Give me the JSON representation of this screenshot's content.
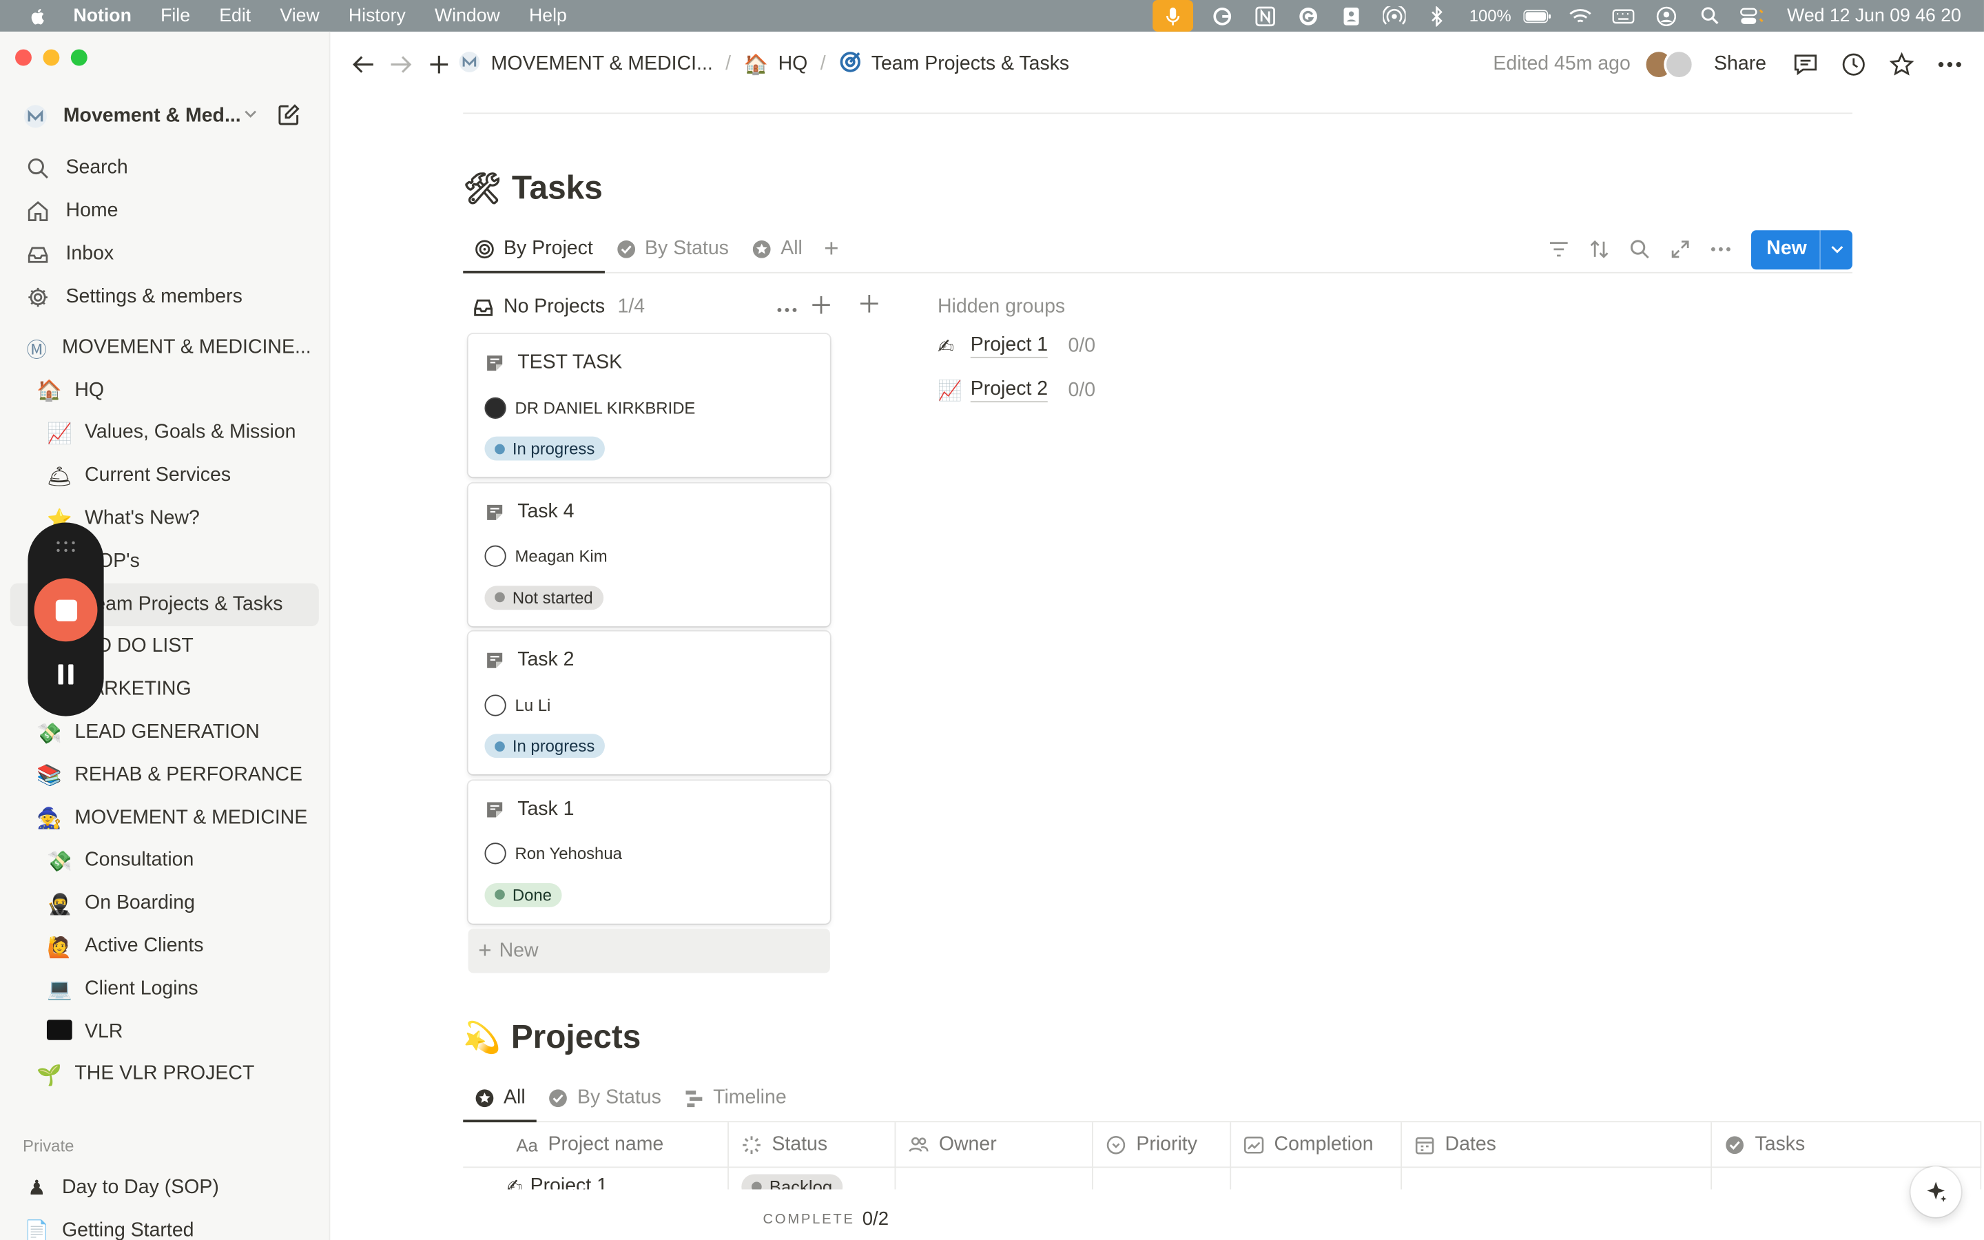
{
  "menubar": {
    "app": "Notion",
    "items": [
      "File",
      "Edit",
      "View",
      "History",
      "Window",
      "Help"
    ],
    "battery": "100%",
    "clock": "Wed 12 Jun  09 46 20"
  },
  "sidebar": {
    "workspace": "Movement & Med...",
    "nav": [
      {
        "label": "Search",
        "icon": "search-icon"
      },
      {
        "label": "Home",
        "icon": "home-icon"
      },
      {
        "label": "Inbox",
        "icon": "inbox-icon"
      },
      {
        "label": "Settings & members",
        "icon": "gear-icon"
      }
    ],
    "tree": [
      {
        "label": "MOVEMENT & MEDICINE...",
        "emoji": "Ⓜ",
        "level": 0
      },
      {
        "label": "HQ",
        "emoji": "🏠",
        "level": 1
      },
      {
        "label": "Values, Goals & Mission",
        "emoji": "📈",
        "level": 2
      },
      {
        "label": "Current Services",
        "emoji": "🛎",
        "level": 2
      },
      {
        "label": "What's New?",
        "emoji": "⭐",
        "level": 2
      },
      {
        "label": "SOP's",
        "emoji": "📄",
        "level": 2
      },
      {
        "label": "Team Projects & Tasks",
        "emoji": "🎯",
        "level": 2,
        "active": true
      },
      {
        "label": "TO DO LIST",
        "emoji": "☑",
        "level": 2
      },
      {
        "label": "MARKETING",
        "emoji": "📣",
        "level": 1
      },
      {
        "label": "LEAD GENERATION",
        "emoji": "💸",
        "level": 1
      },
      {
        "label": "REHAB & PERFORANCE",
        "emoji": "📚",
        "level": 1
      },
      {
        "label": "MOVEMENT & MEDICINE",
        "emoji": "🧙",
        "level": 1
      },
      {
        "label": "Consultation",
        "emoji": "💸",
        "level": 2
      },
      {
        "label": "On Boarding",
        "emoji": "🥷",
        "level": 2
      },
      {
        "label": "Active Clients",
        "emoji": "🙋",
        "level": 2
      },
      {
        "label": "Client Logins",
        "emoji": "💻",
        "level": 2
      },
      {
        "label": "VLR",
        "emoji": "▪",
        "level": 2
      },
      {
        "label": "THE VLR PROJECT",
        "emoji": "🌱",
        "level": 1
      }
    ],
    "private_label": "Private",
    "private": [
      {
        "label": "Day to Day (SOP)",
        "emoji": "♟"
      },
      {
        "label": "Getting Started",
        "emoji": "📄"
      }
    ]
  },
  "topbar": {
    "breadcrumb": [
      "MOVEMENT & MEDICI...",
      "HQ",
      "Team Projects & Tasks"
    ],
    "edited": "Edited 45m ago",
    "share": "Share"
  },
  "tasks_db": {
    "emoji": "🛠",
    "title": "Tasks",
    "tabs": [
      "By Project",
      "By Status",
      "All"
    ],
    "new_button": "New",
    "group": {
      "title": "No Projects",
      "count": "1/4"
    },
    "cards": [
      {
        "title": "TEST TASK",
        "owner": "DR DANIEL KIRKBRIDE",
        "status": "In progress",
        "status_kind": "inprogress"
      },
      {
        "title": "Task 4",
        "owner": "Meagan Kim",
        "status": "Not started",
        "status_kind": "notstarted"
      },
      {
        "title": "Task 2",
        "owner": "Lu Li",
        "status": "In progress",
        "status_kind": "inprogress"
      },
      {
        "title": "Task 1",
        "owner": "Ron Yehoshua",
        "status": "Done",
        "status_kind": "done"
      }
    ],
    "new_card": "New",
    "hidden_label": "Hidden groups",
    "hidden_groups": [
      {
        "emoji": "✍",
        "name": "Project 1",
        "count": "0/0"
      },
      {
        "emoji": "📈",
        "name": "Project 2",
        "count": "0/0"
      }
    ]
  },
  "projects_db": {
    "emoji": "💫",
    "title": "Projects",
    "tabs": [
      "All",
      "By Status",
      "Timeline"
    ],
    "columns": [
      "Project name",
      "Status",
      "Owner",
      "Priority",
      "Completion",
      "Dates",
      "Tasks"
    ],
    "row": {
      "name": "Project 1",
      "emoji": "✍",
      "status": "Backlog"
    },
    "complete_label": "COMPLETE",
    "complete_value": "0/2"
  },
  "colors": {
    "accent": "#2383e2",
    "record": "#f0674d",
    "sidebar_bg": "#f7f7f5"
  }
}
